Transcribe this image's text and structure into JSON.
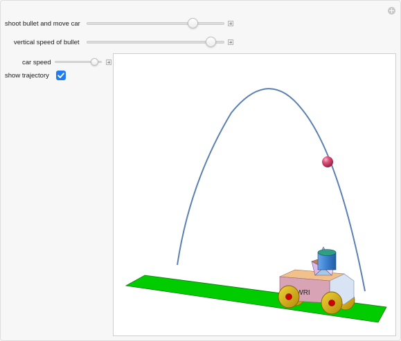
{
  "controls": {
    "shoot_label": "shoot bullet and move car",
    "vertical_speed_label": "vertical speed of bullet",
    "car_speed_label": "car speed",
    "show_trajectory_label": "show trajectory",
    "shoot_value_fraction": 0.77,
    "vertical_speed_value_fraction": 0.9,
    "car_speed_value_fraction": 0.8,
    "show_trajectory_checked": true
  },
  "scene": {
    "car_label": "WRI",
    "colors": {
      "track": "#00cc00",
      "trajectory": "#5b7fb0",
      "bullet": "#d12f5c",
      "car_body": "#d9a3b6",
      "wheel": "#d4ad14",
      "hub": "#cc0000",
      "accent": "#1f7cf2"
    }
  }
}
